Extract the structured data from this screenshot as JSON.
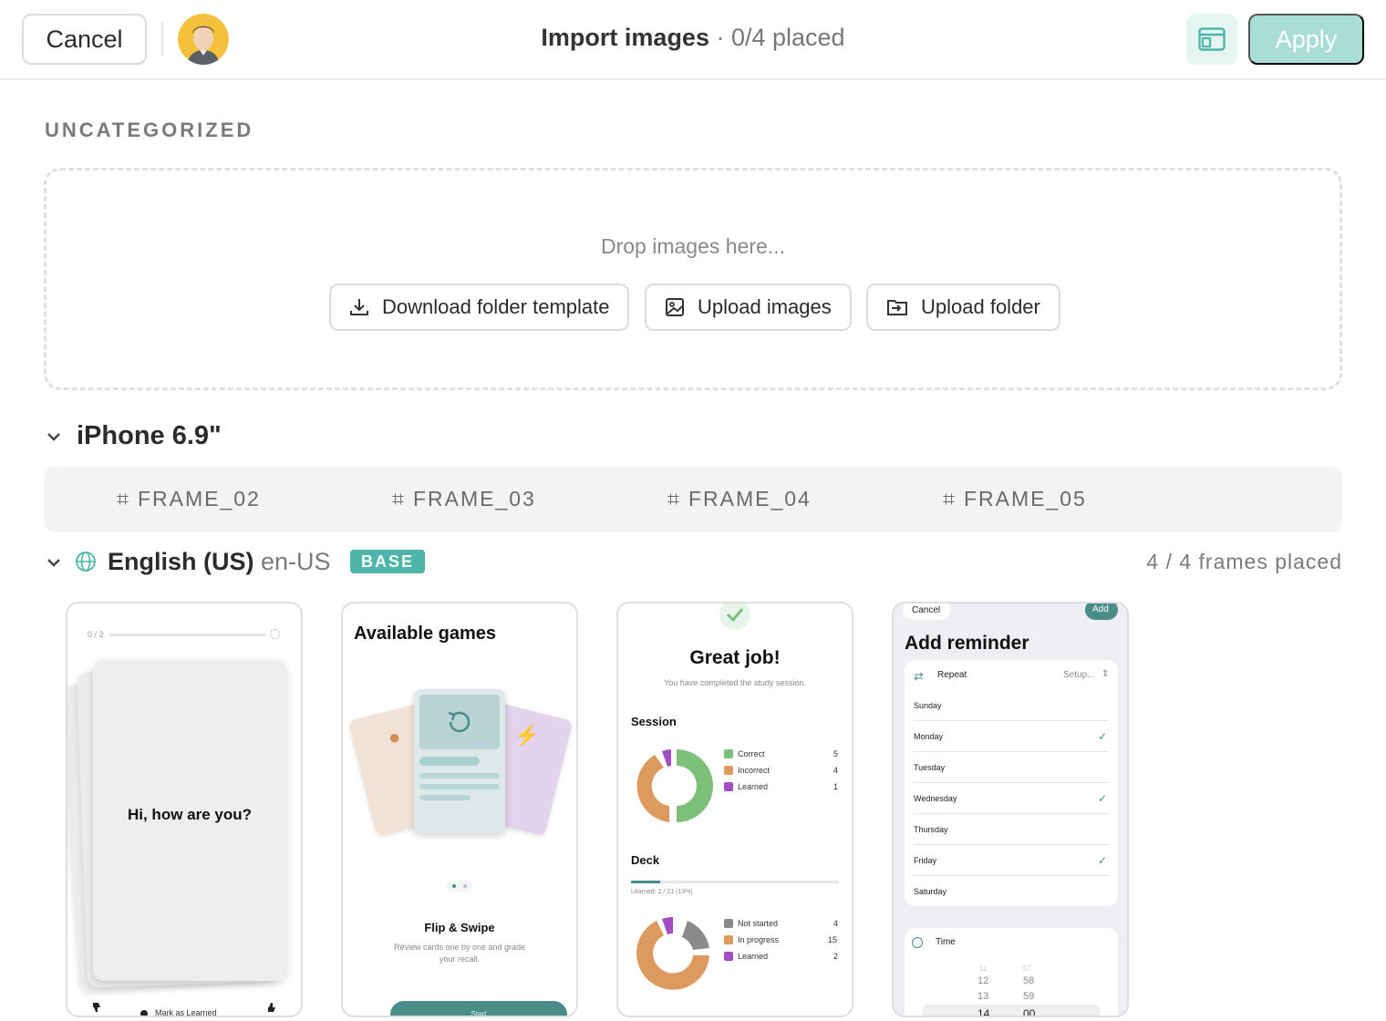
{
  "header": {
    "cancel_label": "Cancel",
    "title": "Import images",
    "subtitle": "· 0/4 placed",
    "apply_label": "Apply"
  },
  "uncategorized": {
    "label": "UNCATEGORIZED",
    "drop_text": "Drop images here...",
    "buttons": {
      "download": "Download folder template",
      "upload_images": "Upload images",
      "upload_folder": "Upload folder"
    }
  },
  "device": {
    "name": "iPhone 6.9\"",
    "frames": [
      "FRAME_02",
      "FRAME_03",
      "FRAME_04",
      "FRAME_05"
    ]
  },
  "language": {
    "name": "English (US)",
    "code": "en-US",
    "badge": "BASE",
    "placed": "4 / 4 frames placed"
  },
  "screens": {
    "s1": {
      "progress": "0 / 2",
      "card_text": "Hi, how are you?",
      "footer": "Mark as Learned"
    },
    "s2": {
      "title": "Available games",
      "game_title": "Flip & Swipe",
      "game_desc_1": "Review cards one by one and grade",
      "game_desc_2": "your recall.",
      "start": "Start"
    },
    "s3": {
      "title": "Great job!",
      "subtitle": "You have completed the study session.",
      "session_label": "Session",
      "session_rows": [
        {
          "label": "Correct",
          "value": "5",
          "color": "#7cc07a"
        },
        {
          "label": "Incorrect",
          "value": "4",
          "color": "#dd9a5e"
        },
        {
          "label": "Learned",
          "value": "1",
          "color": "#a24cc6"
        }
      ],
      "deck_label": "Deck",
      "deck_progress": "Learned: 2 / 21 (13%)",
      "deck_rows": [
        {
          "label": "Not started",
          "value": "4",
          "color": "#8a8a8a"
        },
        {
          "label": "In progress",
          "value": "15",
          "color": "#dd9a5e"
        },
        {
          "label": "Learned",
          "value": "2",
          "color": "#a24cc6"
        }
      ]
    },
    "s4": {
      "cancel": "Cancel",
      "add": "Add",
      "title": "Add reminder",
      "repeat": "Repeat",
      "setup": "Setup...",
      "days": [
        {
          "label": "Sunday",
          "checked": false
        },
        {
          "label": "Monday",
          "checked": true
        },
        {
          "label": "Tuesday",
          "checked": false
        },
        {
          "label": "Wednesday",
          "checked": true
        },
        {
          "label": "Thursday",
          "checked": false
        },
        {
          "label": "Friday",
          "checked": true
        },
        {
          "label": "Saturday",
          "checked": false
        }
      ],
      "time": "Time",
      "hours": [
        "11",
        "12",
        "13",
        "14"
      ],
      "minutes": [
        "57",
        "58",
        "59",
        "00"
      ]
    }
  },
  "colors": {
    "accent": "#4db6a8",
    "apply_disabled": "#a9ddd6",
    "teal_dark": "#4a8c88"
  }
}
